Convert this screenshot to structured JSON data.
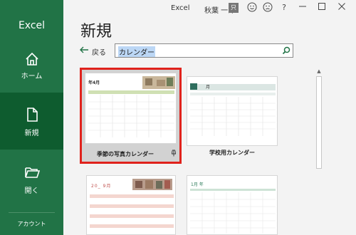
{
  "app": {
    "name": "Excel"
  },
  "titlebar": {
    "app_name": "Excel",
    "user_name": "秋葉 一郎",
    "avatar_text": "只"
  },
  "nav": {
    "home": "ホーム",
    "new": "新規",
    "open": "開く",
    "account": "アカウント"
  },
  "page": {
    "title": "新規"
  },
  "back": {
    "label": "戻る"
  },
  "search": {
    "value": "カレンダー"
  },
  "templates": [
    {
      "label": "季節の写真カレンダー",
      "thumb_heading": "年4月",
      "selected": true
    },
    {
      "label": "学校用カレンダー",
      "thumb_heading": "月",
      "selected": false
    },
    {
      "label": "",
      "thumb_heading": "20_ 9月",
      "selected": false
    },
    {
      "label": "",
      "thumb_heading": "1月 年",
      "selected": false
    }
  ],
  "colors": {
    "sidebar_bg": "#217346",
    "sidebar_selected": "#0e5c2f",
    "selection_border": "#e0221c",
    "accent": "#217346"
  },
  "icons": {
    "home": "home-icon",
    "new": "document-icon",
    "open": "folder-icon",
    "search": "search-icon",
    "pin": "pin-icon"
  }
}
